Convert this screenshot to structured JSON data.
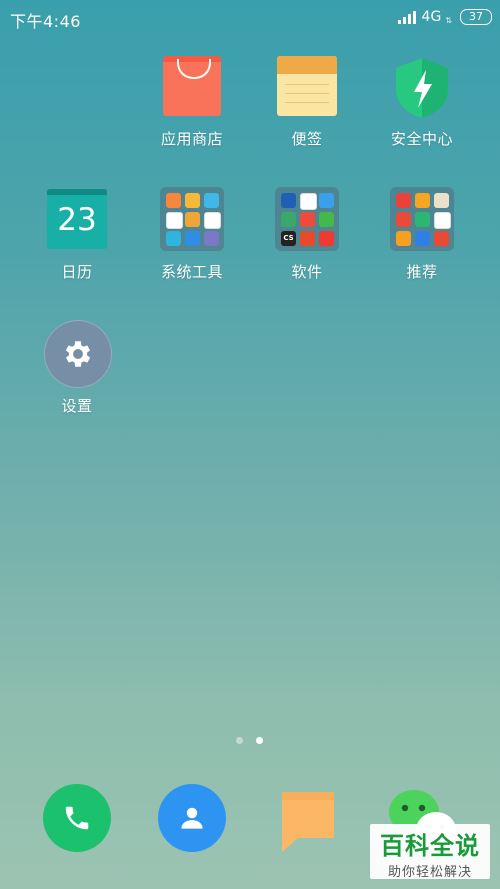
{
  "status_bar": {
    "time": "下午4:46",
    "network": "4G",
    "battery": "37"
  },
  "apps": {
    "app_store": {
      "label": "应用商店"
    },
    "notes": {
      "label": "便签"
    },
    "security": {
      "label": "安全中心"
    },
    "calendar": {
      "label": "日历",
      "day": "23"
    },
    "system_tools": {
      "label": "系统工具"
    },
    "software": {
      "label": "软件"
    },
    "recommended": {
      "label": "推荐"
    },
    "settings": {
      "label": "设置"
    }
  },
  "folders": {
    "system_tools_icons": [
      "#f7873c",
      "#f5b83a",
      "#3fb8e6",
      "#ffffff",
      "#f0a536",
      "#ffffff",
      "#2fb4e0",
      "#2f8de6",
      "#7b78c8"
    ],
    "software_icons": [
      "#1f5fb5",
      "#ffffff",
      "#3aa0ea",
      "#3aa86a",
      "#ef4a3a",
      "#44b848",
      "#222222",
      "#e84a2a",
      "#ee3a30"
    ],
    "software_texts": [
      "",
      "",
      "",
      "",
      "",
      "",
      "CS",
      "",
      ""
    ],
    "recommended_icons": [
      "#e8423a",
      "#f5a623",
      "#e9e1c8",
      "#e94a3a",
      "#2bb673",
      "#ffffff",
      "#f5a020",
      "#2f7fe6",
      "#e84a35"
    ]
  },
  "page_indicator": {
    "total": 2,
    "active": 1
  },
  "dock": {
    "phone": {
      "color": "#1bc16c"
    },
    "contacts": {
      "color": "#2e94f2"
    },
    "messages": {
      "color": "#fbb766"
    },
    "wechat": {
      "color": "#4cd35c"
    }
  },
  "watermark": {
    "title": "百科全说",
    "subtitle": "助你轻松解决"
  },
  "colors": {
    "app_store": "#f9735b",
    "notes_top": "#eeaa48",
    "notes_body": "#fbe5a2",
    "security": "#27c980",
    "calendar": "#18b0a6",
    "settings": "#778ea7",
    "watermark_green": "#1a9a3a"
  }
}
